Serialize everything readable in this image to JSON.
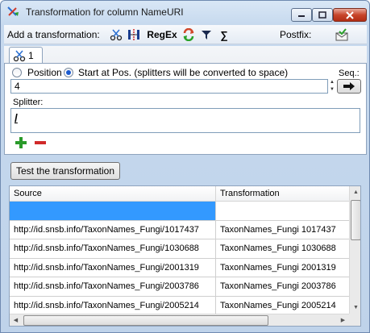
{
  "window": {
    "title": "Transformation for column NameURI"
  },
  "toolbar": {
    "add_label": "Add a transformation:",
    "regex_label": "RegEx",
    "sigma_label": "∑",
    "postfix_label": "Postfix:"
  },
  "tabs": [
    {
      "label": "1"
    }
  ],
  "options": {
    "position_label": "Position",
    "start_at_pos_label": "Start at Pos. (splitters will be converted to space)",
    "selected": "start_at_pos",
    "seq_label": "Seq.:",
    "position_value": "4",
    "splitter_label": "Splitter:",
    "splitter_value": "/"
  },
  "actions": {
    "test_label": "Test the transformation"
  },
  "grid": {
    "columns": [
      "Source",
      "Transformation"
    ],
    "rows": [
      {
        "source": "",
        "transformation": ""
      },
      {
        "source": "http://id.snsb.info/TaxonNames_Fungi/1017437",
        "transformation": "TaxonNames_Fungi 1017437"
      },
      {
        "source": "http://id.snsb.info/TaxonNames_Fungi/1030688",
        "transformation": "TaxonNames_Fungi 1030688"
      },
      {
        "source": "http://id.snsb.info/TaxonNames_Fungi/2001319",
        "transformation": "TaxonNames_Fungi 2001319"
      },
      {
        "source": "http://id.snsb.info/TaxonNames_Fungi/2003786",
        "transformation": "TaxonNames_Fungi 2003786"
      },
      {
        "source": "http://id.snsb.info/TaxonNames_Fungi/2005214",
        "transformation": "TaxonNames_Fungi 2005214"
      }
    ]
  }
}
